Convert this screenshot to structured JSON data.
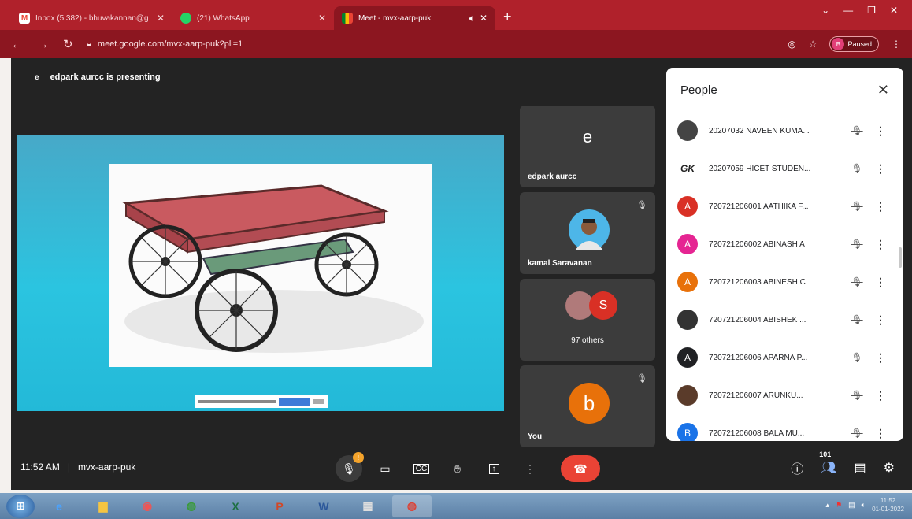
{
  "browser": {
    "tabs": [
      {
        "title": "Inbox (5,382) - bhuvakannan@g",
        "icon": "gmail-icon",
        "color": "#ea4335",
        "active": false
      },
      {
        "title": "(21) WhatsApp",
        "icon": "whatsapp-icon",
        "color": "#25d366",
        "active": false
      },
      {
        "title": "Meet - mvx-aarp-puk",
        "icon": "meet-icon",
        "color": "#fbbc04",
        "active": true
      }
    ],
    "url": "meet.google.com/mvx-aarp-puk?pli=1",
    "profile_label": "Paused",
    "profile_initial": "B"
  },
  "meet": {
    "presenter_initial": "e",
    "presenting_text": "edpark aurcc is presenting",
    "tiles": [
      {
        "name": "edpark aurcc",
        "initial": "e",
        "color": "#3c3c3c"
      },
      {
        "name": "kamal Saravanan",
        "photo": true
      },
      {
        "others": "97 others",
        "initial": "S",
        "color": "#d93025"
      },
      {
        "name": "You",
        "initial": "b",
        "color": "#e8710a"
      }
    ]
  },
  "people": {
    "title": "People",
    "list": [
      {
        "name": "20207032 NAVEEN KUMA...",
        "initial": "",
        "color": "#444444"
      },
      {
        "name": "20207059 HICET STUDEN...",
        "initial": "GK",
        "color": "#ffffff"
      },
      {
        "name": "720721206001 AATHIKA F...",
        "initial": "A",
        "color": "#d93025"
      },
      {
        "name": "720721206002 ABINASH A",
        "initial": "A",
        "color": "#e52592"
      },
      {
        "name": "720721206003 ABINESH C",
        "initial": "A",
        "color": "#e8710a"
      },
      {
        "name": "720721206004 ABISHEK ...",
        "initial": "",
        "color": "#333333"
      },
      {
        "name": "720721206006 APARNA P...",
        "initial": "A",
        "color": "#202124"
      },
      {
        "name": "720721206007 ARUNKU...",
        "initial": "",
        "color": "#5a3b2a"
      },
      {
        "name": "720721206008 BALA MU...",
        "initial": "B",
        "color": "#1a73e8"
      }
    ]
  },
  "bottombar": {
    "time": "11:52 AM",
    "separator": "|",
    "code": "mvx-aarp-puk",
    "people_count": "101"
  },
  "taskbar": {
    "clock_time": "11:52",
    "clock_date": "01-01-2022"
  }
}
